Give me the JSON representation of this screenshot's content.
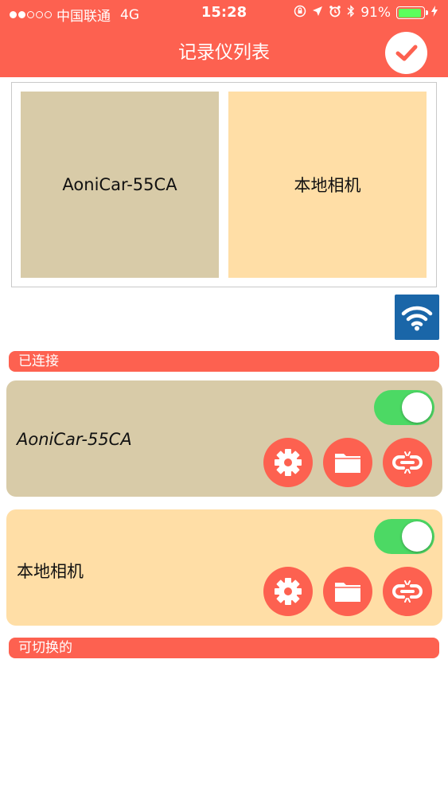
{
  "status_bar": {
    "carrier": "中国联通",
    "network": "4G",
    "time": "15:28",
    "battery": "91%",
    "battery_level": 0.91,
    "icons": [
      "lock-rotation-icon",
      "location-arrow-icon",
      "alarm-icon",
      "bluetooth-icon",
      "battery-icon",
      "charging-icon"
    ]
  },
  "header": {
    "title": "记录仪列表",
    "confirm_icon": "checkmark-icon"
  },
  "grid": {
    "items": [
      {
        "label": "AoniCar-55CA",
        "color": "#d8cba8"
      },
      {
        "label": "本地相机",
        "color": "#ffdea6"
      }
    ]
  },
  "wifi_button": {
    "icon": "wifi-icon",
    "color": "#1a66a8"
  },
  "sections": {
    "connected": "已连接",
    "switchable": "可切换的"
  },
  "devices": [
    {
      "name": "AoniCar-55CA",
      "enabled": true,
      "color": "#d8cba8"
    },
    {
      "name": "本地相机",
      "enabled": true,
      "color": "#ffdea6"
    }
  ],
  "device_actions": [
    "settings-icon",
    "folder-icon",
    "unlink-icon"
  ],
  "colors": {
    "accent": "#fd6150",
    "toggle_on": "#4cd964",
    "wifi_blue": "#1a66a8"
  }
}
